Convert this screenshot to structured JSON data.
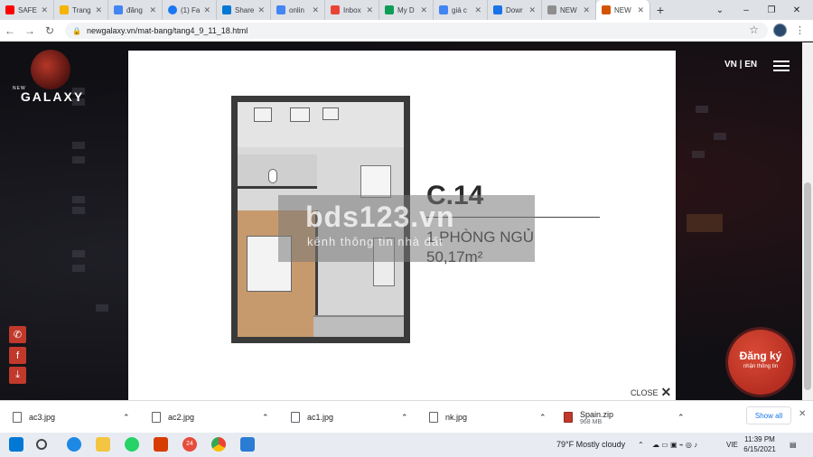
{
  "browser": {
    "tabs": [
      {
        "label": "SAFE",
        "color": "#ff0000"
      },
      {
        "label": "Trang",
        "color": "#f4b400"
      },
      {
        "label": "đăng",
        "color": "#4285f4"
      },
      {
        "label": "(1) Fa",
        "color": "#1877f2"
      },
      {
        "label": "Share",
        "color": "#0078d4"
      },
      {
        "label": "onlin",
        "color": "#4285f4"
      },
      {
        "label": "Inbox",
        "color": "#ea4335"
      },
      {
        "label": "My D",
        "color": "#0f9d58"
      },
      {
        "label": "giá c",
        "color": "#4285f4"
      },
      {
        "label": "Dowr",
        "color": "#1a73e8"
      },
      {
        "label": "NEW",
        "color": "#8e8e8e"
      },
      {
        "label": "NEW",
        "color": "#d35400"
      }
    ],
    "new_tab": "+",
    "url": "newgalaxy.vn/mat-bang/tang4_9_11_18.html",
    "window": {
      "minimize": "–",
      "restore": "❐",
      "close": "✕"
    }
  },
  "site": {
    "logo_small": "NEW",
    "logo_word": "GALAXY",
    "lang": "VN | EN",
    "register": {
      "title": "Đăng ký",
      "subtitle": "nhận thông tin"
    }
  },
  "modal": {
    "unit_code": "C.14",
    "unit_type": "1 PHÒNG NGỦ",
    "unit_area": "50,17m²",
    "watermark_title": "bds123.vn",
    "watermark_sub": "kênh thông tin nhà đất",
    "close_label": "CLOSE"
  },
  "downloads": {
    "items": [
      {
        "name": "ac3.jpg",
        "size": ""
      },
      {
        "name": "ac2.jpg",
        "size": ""
      },
      {
        "name": "ac1.jpg",
        "size": ""
      },
      {
        "name": "nk.jpg",
        "size": ""
      },
      {
        "name": "Spain.zip",
        "size": "968 MB"
      }
    ],
    "show_all": "Show all"
  },
  "taskbar": {
    "weather": "79°F  Mostly cloudy",
    "lang": "VIE",
    "time": "11:39 PM",
    "date": "6/15/2021",
    "notifications": "24"
  }
}
